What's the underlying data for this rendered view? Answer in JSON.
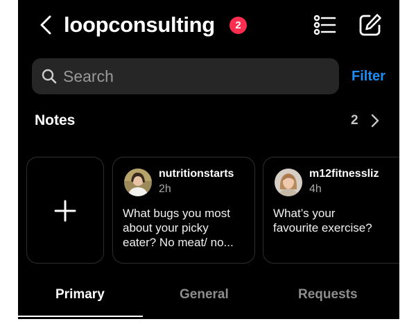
{
  "header": {
    "title": "loopconsulting",
    "badge_count": "2",
    "back_icon": "chevron-left-icon",
    "list_icon": "list-icon",
    "compose_icon": "compose-icon"
  },
  "search": {
    "placeholder": "Search",
    "filter_label": "Filter",
    "accent_color": "#1d8df2"
  },
  "notes": {
    "title": "Notes",
    "count": "2",
    "items": [
      {
        "username": "nutritionstarts",
        "time": "2h",
        "text": "What bugs you most\nabout your picky\neater? No meat/ no..."
      },
      {
        "username": "m12fitnessliz",
        "time": "4h",
        "text": "What’s your\nfavourite exercise?"
      }
    ]
  },
  "tabs": [
    {
      "label": "Primary",
      "active": true
    },
    {
      "label": "General",
      "active": false
    },
    {
      "label": "Requests",
      "active": false
    }
  ]
}
